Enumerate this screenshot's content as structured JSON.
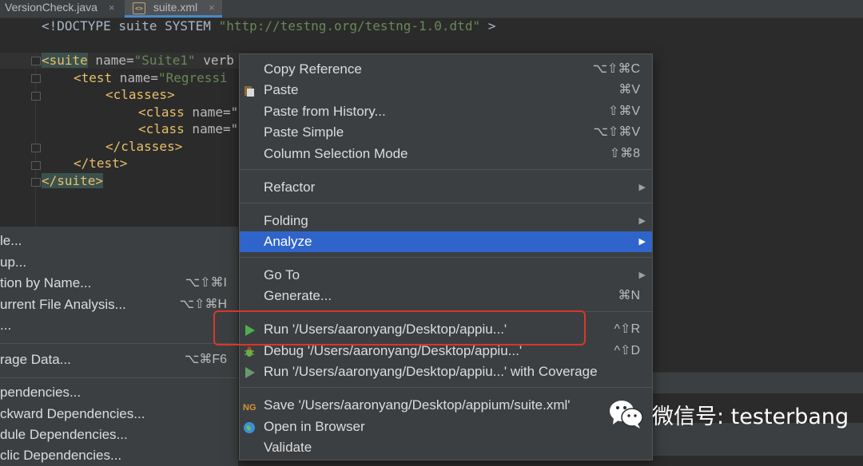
{
  "tabs": [
    {
      "label": "VersionCheck.java",
      "close": "×"
    },
    {
      "label": "suite.xml",
      "close": "×",
      "icon": "xml-file-icon"
    }
  ],
  "code": {
    "doctype_a": "<!DOCTYPE suite SYSTEM ",
    "doctype_b": "\"http://testng.org/testng-1.0.dtd\"",
    "doctype_c": " >",
    "l2_tag": "<suite",
    "l2_attr": " name=",
    "l2_val": "\"Suite1\"",
    "l2_rest": " verb",
    "l3_tag": "<test",
    "l3_attr": " name=",
    "l3_val": "\"Regressi",
    "l4": "<classes>",
    "l5_tag": "<class",
    "l5_attr": " name=\"",
    "l6_tag": "<class",
    "l6_attr": " name=\"",
    "l7": "</classes>",
    "l8": "</test>",
    "l9": "</suite>"
  },
  "back_menu": [
    {
      "label": "le...",
      "shortcut": ""
    },
    {
      "label": "up...",
      "shortcut": ""
    },
    {
      "label": "tion by Name...",
      "shortcut": "⌥⇧⌘I"
    },
    {
      "label": "urrent File Analysis...",
      "shortcut": "⌥⇧⌘H"
    },
    {
      "label": "...",
      "shortcut": ""
    },
    {
      "label": "rage Data...",
      "shortcut": "⌥⌘F6"
    },
    {
      "label": "pendencies...",
      "shortcut": ""
    },
    {
      "label": "ckward Dependencies...",
      "shortcut": ""
    },
    {
      "label": "dule Dependencies...",
      "shortcut": ""
    },
    {
      "label": "clic Dependencies...",
      "shortcut": ""
    }
  ],
  "context_menu": [
    {
      "label": "Copy Reference",
      "shortcut": "⌥⇧⌘C"
    },
    {
      "label": "Paste",
      "shortcut": "⌘V",
      "icon": "paste-icon"
    },
    {
      "label": "Paste from History...",
      "shortcut": "⇧⌘V"
    },
    {
      "label": "Paste Simple",
      "shortcut": "⌥⇧⌘V"
    },
    {
      "label": "Column Selection Mode",
      "shortcut": "⇧⌘8"
    },
    {
      "label": "Refactor",
      "submenu": "▶"
    },
    {
      "label": "Folding",
      "submenu": "▶"
    },
    {
      "label": "Analyze",
      "submenu": "▶",
      "selected": true
    },
    {
      "label": "Go To",
      "submenu": "▶"
    },
    {
      "label": "Generate...",
      "shortcut": "⌘N"
    },
    {
      "label": "Run '/Users/aaronyang/Desktop/appiu...'",
      "shortcut": "^⇧R",
      "icon": "run-icon"
    },
    {
      "label": "Debug '/Users/aaronyang/Desktop/appiu...'",
      "shortcut": "^⇧D",
      "icon": "debug-icon"
    },
    {
      "label": "Run '/Users/aaronyang/Desktop/appiu...' with Coverage",
      "shortcut": "",
      "icon": "coverage-icon"
    },
    {
      "label": "Save '/Users/aaronyang/Desktop/appium/suite.xml'",
      "shortcut": "",
      "icon": "testng-icon"
    },
    {
      "label": "Open in Browser",
      "shortcut": "",
      "icon": "browser-icon"
    },
    {
      "label": "Validate",
      "shortcut": ""
    }
  ],
  "watermark": {
    "text": "微信号: testerbang",
    "icon": "wechat-icon"
  },
  "colors": {
    "selection": "#2f65ca",
    "highlight_box": "#d9362c",
    "run_green": "#4caf50"
  }
}
